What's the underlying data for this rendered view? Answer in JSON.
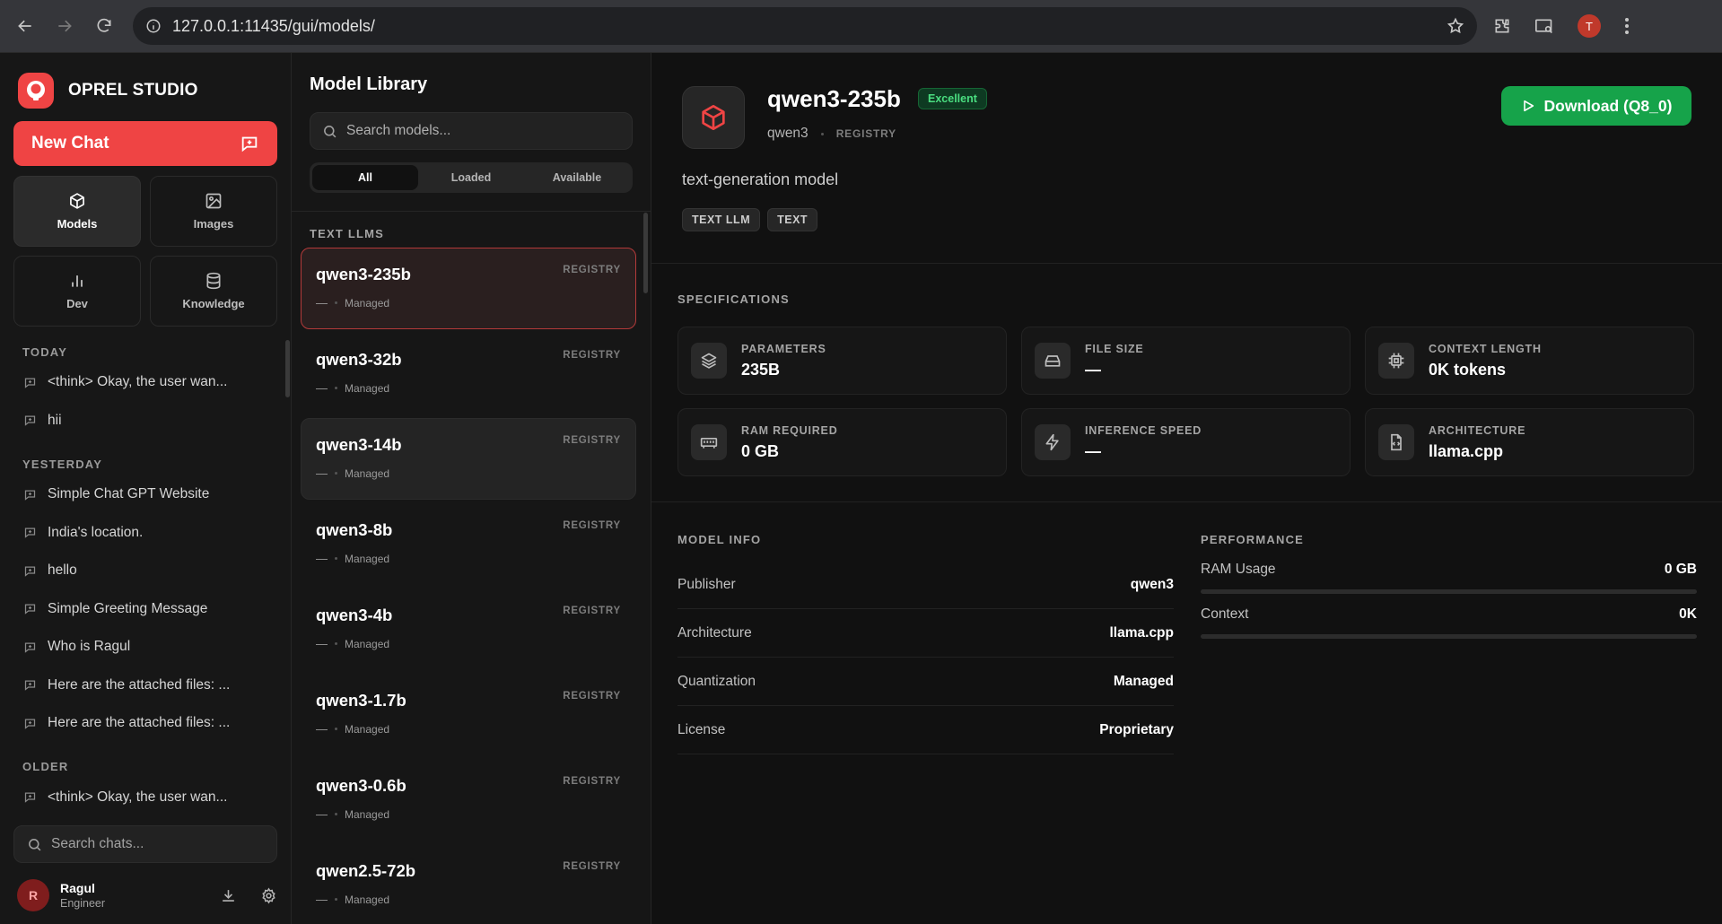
{
  "browser": {
    "url": "127.0.0.1:11435/gui/models/",
    "profile_initial": "T"
  },
  "sidebar": {
    "brand": "OPREL STUDIO",
    "new_chat_label": "New Chat",
    "nav": [
      {
        "label": "Models",
        "icon": "cube-icon",
        "active": true
      },
      {
        "label": "Images",
        "icon": "image-icon",
        "active": false
      },
      {
        "label": "Dev",
        "icon": "bar-chart-icon",
        "active": false
      },
      {
        "label": "Knowledge",
        "icon": "database-icon",
        "active": false
      }
    ],
    "sections": [
      {
        "label": "TODAY",
        "items": [
          "<think> Okay, the user wan...",
          "hii"
        ]
      },
      {
        "label": "YESTERDAY",
        "items": [
          "Simple Chat GPT Website",
          "India's location.",
          "hello",
          "Simple Greeting Message",
          "Who is Ragul",
          "Here are the attached files: ...",
          "Here are the attached files: ..."
        ]
      },
      {
        "label": "OLDER",
        "items": [
          "<think> Okay, the user wan..."
        ]
      }
    ],
    "search_placeholder": "Search chats...",
    "user": {
      "initial": "R",
      "name": "Ragul",
      "role": "Engineer"
    }
  },
  "library": {
    "title": "Model Library",
    "search_placeholder": "Search models...",
    "filters": [
      "All",
      "Loaded",
      "Available"
    ],
    "active_filter": 0,
    "section_label": "TEXT LLMS",
    "models": [
      {
        "name": "qwen3-235b",
        "source": "REGISTRY",
        "size": "—",
        "quant": "Managed",
        "state": "selected"
      },
      {
        "name": "qwen3-32b",
        "source": "REGISTRY",
        "size": "—",
        "quant": "Managed",
        "state": ""
      },
      {
        "name": "qwen3-14b",
        "source": "REGISTRY",
        "size": "—",
        "quant": "Managed",
        "state": "hover"
      },
      {
        "name": "qwen3-8b",
        "source": "REGISTRY",
        "size": "—",
        "quant": "Managed",
        "state": ""
      },
      {
        "name": "qwen3-4b",
        "source": "REGISTRY",
        "size": "—",
        "quant": "Managed",
        "state": ""
      },
      {
        "name": "qwen3-1.7b",
        "source": "REGISTRY",
        "size": "—",
        "quant": "Managed",
        "state": ""
      },
      {
        "name": "qwen3-0.6b",
        "source": "REGISTRY",
        "size": "—",
        "quant": "Managed",
        "state": ""
      },
      {
        "name": "qwen2.5-72b",
        "source": "REGISTRY",
        "size": "—",
        "quant": "Managed",
        "state": ""
      }
    ]
  },
  "detail": {
    "name": "qwen3-235b",
    "badge": "Excellent",
    "publisher": "qwen3",
    "source": "REGISTRY",
    "description": "text-generation model",
    "tags": [
      "TEXT LLM",
      "TEXT"
    ],
    "download_label": "Download (Q8_0)",
    "specs_label": "SPECIFICATIONS",
    "specs": [
      {
        "key": "PARAMETERS",
        "value": "235B",
        "icon": "layers-icon"
      },
      {
        "key": "FILE SIZE",
        "value": "—",
        "icon": "hard-drive-icon"
      },
      {
        "key": "CONTEXT LENGTH",
        "value": "0K tokens",
        "icon": "cpu-icon"
      },
      {
        "key": "RAM REQUIRED",
        "value": "0 GB",
        "icon": "memory-icon"
      },
      {
        "key": "INFERENCE SPEED",
        "value": "—",
        "icon": "lightning-icon"
      },
      {
        "key": "ARCHITECTURE",
        "value": "llama.cpp",
        "icon": "file-code-icon"
      }
    ],
    "info_label": "MODEL INFO",
    "info": [
      {
        "key": "Publisher",
        "value": "qwen3"
      },
      {
        "key": "Architecture",
        "value": "llama.cpp"
      },
      {
        "key": "Quantization",
        "value": "Managed"
      },
      {
        "key": "License",
        "value": "Proprietary"
      }
    ],
    "perf_label": "PERFORMANCE",
    "performance": [
      {
        "key": "RAM Usage",
        "value": "0 GB",
        "fraction": 0
      },
      {
        "key": "Context",
        "value": "0K",
        "fraction": 0
      }
    ]
  },
  "colors": {
    "accent": "#ef4444",
    "success": "#16a34a",
    "background": "#111111"
  }
}
